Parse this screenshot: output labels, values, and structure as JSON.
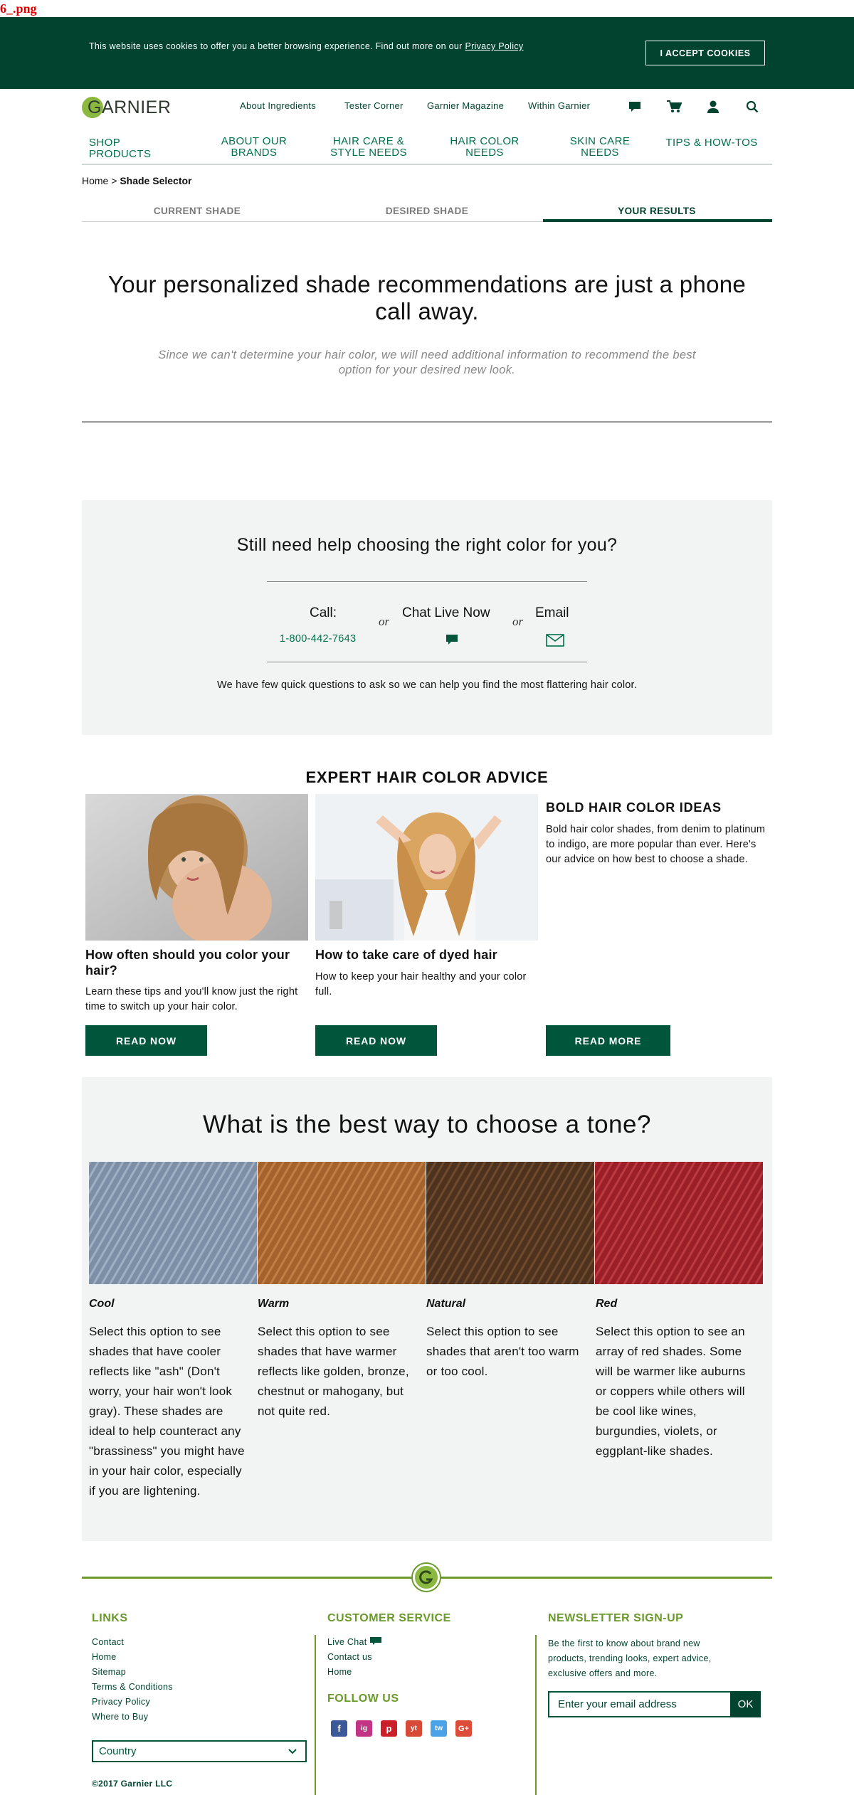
{
  "file_label": "6_.png",
  "cookie": {
    "text": "This website uses cookies to offer you a better browsing experience. Find out more on our",
    "link": "Privacy Policy",
    "button": "I ACCEPT COOKIES"
  },
  "header": {
    "logo": "GARNIER",
    "top_links": [
      "About Ingredients",
      "Tester Corner",
      "Garnier Magazine",
      "Within Garnier"
    ],
    "main_nav": [
      "SHOP PRODUCTS",
      "ABOUT OUR BRANDS",
      "HAIR CARE & STYLE NEEDS",
      "HAIR COLOR NEEDS",
      "SKIN CARE NEEDS",
      "TIPS & HOW-TOS"
    ],
    "icons": [
      "chat-icon",
      "cart-icon",
      "account-icon",
      "search-icon"
    ]
  },
  "breadcrumb": {
    "home": "Home",
    "sep": ">",
    "current": "Shade Selector"
  },
  "steps": [
    "CURRENT SHADE",
    "DESIRED SHADE",
    "YOUR RESULTS"
  ],
  "hero": {
    "title": "Your personalized shade recommendations are just a phone call away.",
    "subtitle": "Since we can't determine your hair color, we will need additional information to recommend the best option for your desired new look."
  },
  "help": {
    "title": "Still need help choosing the right color for you?",
    "call_label": "Call:",
    "phone": "1-800-442-7643",
    "or": "or",
    "chat_label": "Chat Live Now",
    "email_label": "Email",
    "note": "We have few quick questions to ask so we can help you find the most flattering hair color."
  },
  "expert": {
    "title": "EXPERT HAIR COLOR ADVICE",
    "cards": [
      {
        "title": "How often should you color your hair?",
        "text": "Learn these tips and you'll know just the right time to switch up your hair color.",
        "button": "READ NOW"
      },
      {
        "title": "How to take care of dyed hair",
        "text": "How to keep your hair healthy and your color full.",
        "button": "READ NOW"
      },
      {
        "title": "BOLD HAIR COLOR IDEAS",
        "text": "Bold hair color shades, from denim to platinum to indigo, are more popular than ever. Here's our advice on how best to choose a shade.",
        "button": "READ MORE"
      }
    ]
  },
  "tone": {
    "title": "What is the best way to choose a tone?",
    "items": [
      {
        "name": "Cool",
        "text": "Select this option to see shades that have cooler reflects like \"ash\" (Don't worry, your hair won't look gray). These shades are ideal to help counteract any \"brassiness\" you might have in your hair color, especially if you are lightening.",
        "color": "#7d8fa6"
      },
      {
        "name": "Warm",
        "text": "Select this option to see shades that have warmer reflects like golden, bronze, chestnut or mahogany, but not quite red.",
        "color": "#a4622c"
      },
      {
        "name": "Natural",
        "text": "Select this option to see shades that aren't too warm or too cool.",
        "color": "#5a3a22"
      },
      {
        "name": "Red",
        "text": "Select this option to see an array of red shades. Some will be warmer like auburns or coppers while others will be cool like wines, burgundies, violets, or eggplant-like shades.",
        "color": "#a3252b"
      }
    ]
  },
  "footer": {
    "links_title": "LINKS",
    "links": [
      "Contact",
      "Home",
      "Sitemap",
      "Terms & Conditions",
      "Privacy Policy",
      "Where to Buy"
    ],
    "country": "Country",
    "copyright": "©2017 Garnier LLC",
    "cs_title": "CUSTOMER SERVICE",
    "cs_links": [
      "Live Chat",
      "Contact us",
      "Home"
    ],
    "follow_title": "FOLLOW US",
    "social": [
      "f",
      "ig",
      "p",
      "yt",
      "tw",
      "G+"
    ],
    "news_title": "NEWSLETTER SIGN-UP",
    "news_text": "Be the first to know about brand new products, trending looks, expert advice, exclusive offers and more.",
    "news_placeholder": "Enter your email address",
    "news_button": "OK"
  },
  "colors": {
    "brand_dark": "#00432f",
    "brand_green": "#00704a",
    "accent_lime": "#6a9a2a"
  }
}
